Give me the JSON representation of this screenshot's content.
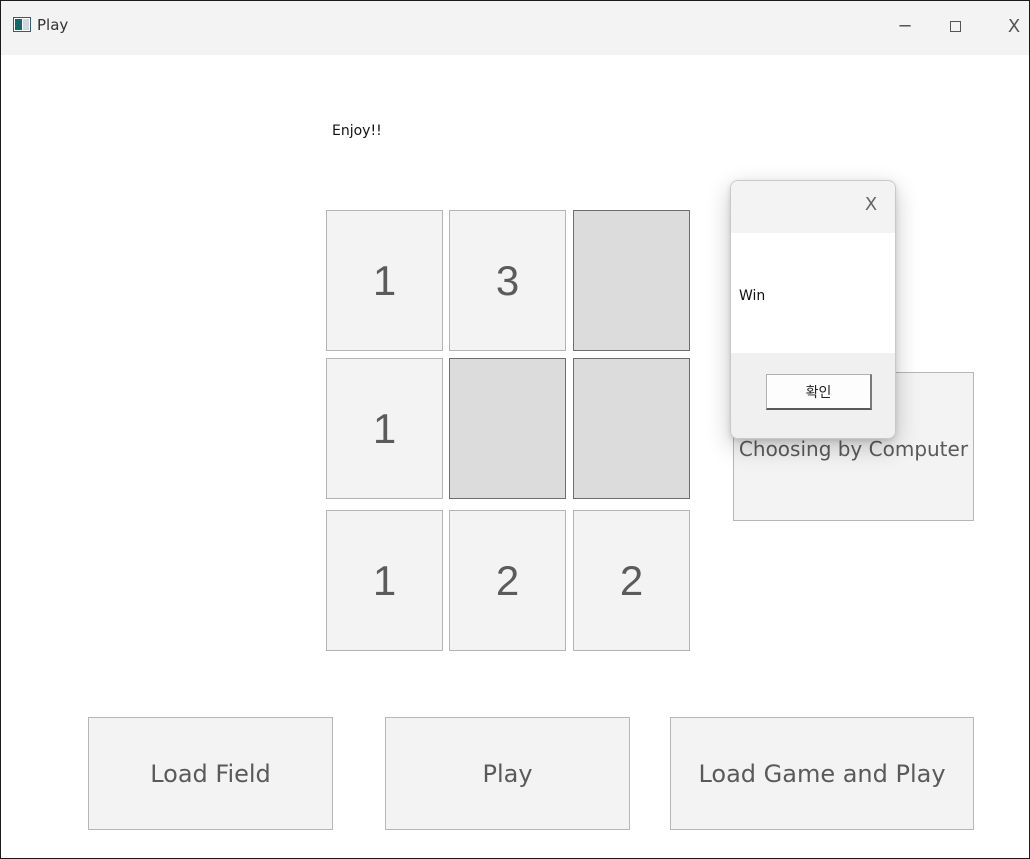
{
  "window": {
    "title": "Play",
    "controls": {
      "minimize": "─",
      "close": "X"
    }
  },
  "status_text": "Enjoy!!",
  "grid": {
    "rows": [
      [
        {
          "value": "1",
          "revealed": true
        },
        {
          "value": "3",
          "revealed": true
        },
        {
          "value": "",
          "revealed": false
        }
      ],
      [
        {
          "value": "1",
          "revealed": true
        },
        {
          "value": "",
          "revealed": false
        },
        {
          "value": "",
          "revealed": false
        }
      ],
      [
        {
          "value": "1",
          "revealed": true
        },
        {
          "value": "2",
          "revealed": true
        },
        {
          "value": "2",
          "revealed": true
        }
      ]
    ]
  },
  "buttons": {
    "choosing_by_computer": "Choosing by Computer",
    "load_field": "Load Field",
    "play": "Play",
    "load_game_and_play": "Load Game and Play"
  },
  "dialog": {
    "close_glyph": "X",
    "message": "Win",
    "ok_label": "확인"
  },
  "colors": {
    "cell_revealed": "#f3f3f3",
    "cell_hidden": "#dcdcdc",
    "titlebar": "#f3f3f3"
  }
}
